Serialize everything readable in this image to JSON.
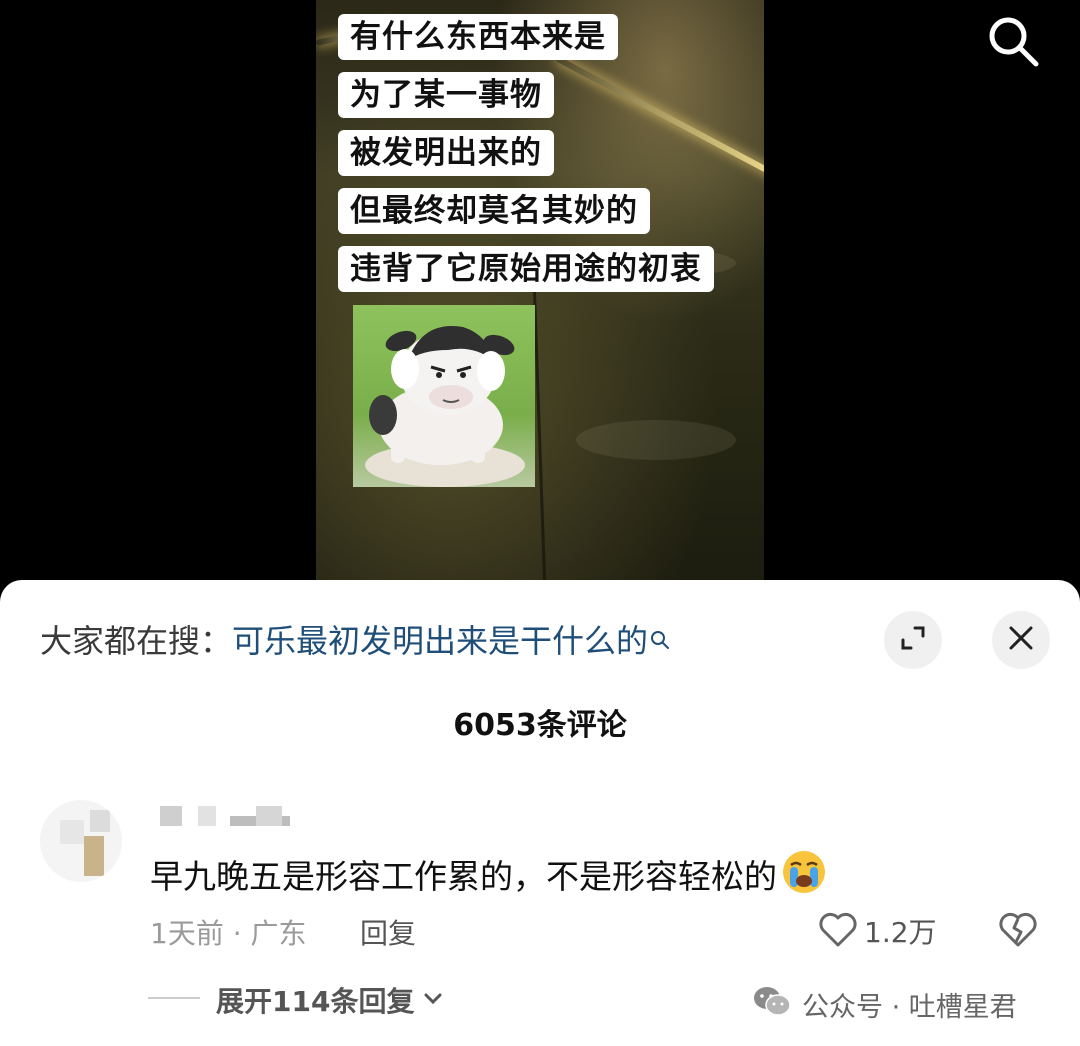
{
  "video": {
    "captions": [
      "有什么东西本来是",
      "为了某一事物",
      "被发明出来的",
      "但最终却莫名其妙的",
      "违背了它原始用途的初衷"
    ],
    "search_icon": "search-icon"
  },
  "sheet": {
    "search_prefix": "大家都在搜：",
    "search_query": "可乐最初发明出来是干什么的",
    "expand_icon": "expand-icon",
    "close_icon": "close-icon",
    "comment_count": "6053条评论"
  },
  "comment": {
    "text": "早九晚五是形容工作累的，不是形容轻松的",
    "time_location": "1天前 · 广东",
    "reply_label": "回复",
    "like_count": "1.2万",
    "expand_replies": "展开114条回复"
  },
  "watermark": {
    "text": "公众号 · 吐槽星君"
  },
  "colors": {
    "query_link": "#1f4e79",
    "sheet_bg": "#ffffff",
    "crying_emoji": "#f7c43c"
  }
}
